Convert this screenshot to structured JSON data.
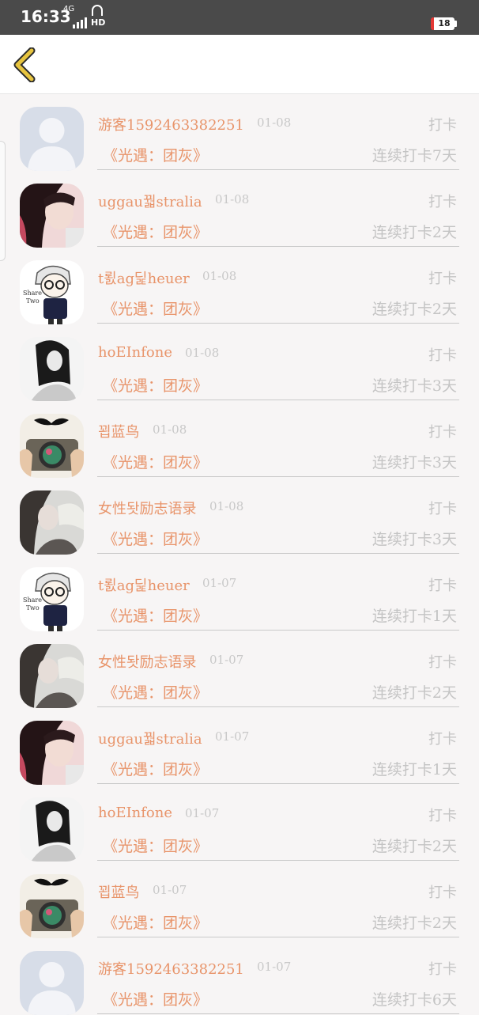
{
  "status_bar": {
    "time": "16:33",
    "network": "4G",
    "hd": "HD",
    "battery": "18"
  },
  "header": {
    "back_icon": "chevron-left-icon"
  },
  "colors": {
    "accent": "#e8946a",
    "muted": "#c4c4c4",
    "back": "#e7c43f"
  },
  "rows": [
    {
      "name": "游客1592463382251",
      "date": "01-08",
      "action": "打卡",
      "book": "《光遇：团灰》",
      "streak": "连续打卡7天",
      "avatar": "default-avatar"
    },
    {
      "name": "uggau꿟stralia",
      "date": "01-08",
      "action": "打卡",
      "book": "《光遇：团灰》",
      "streak": "连续打卡2天",
      "avatar": "girl-photo-avatar"
    },
    {
      "name": "t뢼ag딡heuer",
      "date": "01-08",
      "action": "打卡",
      "book": "《光遇：团灰》",
      "streak": "连续打卡2天",
      "avatar": "cartoon-boy-avatar"
    },
    {
      "name": "hoEInfone",
      "date": "01-08",
      "action": "打卡",
      "book": "《光遇：团灰》",
      "streak": "连续打卡3天",
      "avatar": "bw-girl-avatar"
    },
    {
      "name": "꾑蓝鸟",
      "date": "01-08",
      "action": "打卡",
      "book": "《光遇：团灰》",
      "streak": "连续打卡3天",
      "avatar": "camera-avatar"
    },
    {
      "name": "女性돳励志语录",
      "date": "01-08",
      "action": "打卡",
      "book": "《光遇：团灰》",
      "streak": "连续打卡3天",
      "avatar": "smoke-girl-avatar"
    },
    {
      "name": "t뢼ag딡heuer",
      "date": "01-07",
      "action": "打卡",
      "book": "《光遇：团灰》",
      "streak": "连续打卡1天",
      "avatar": "cartoon-boy-avatar"
    },
    {
      "name": "女性돳励志语录",
      "date": "01-07",
      "action": "打卡",
      "book": "《光遇：团灰》",
      "streak": "连续打卡2天",
      "avatar": "smoke-girl-avatar"
    },
    {
      "name": "uggau꿟stralia",
      "date": "01-07",
      "action": "打卡",
      "book": "《光遇：团灰》",
      "streak": "连续打卡1天",
      "avatar": "girl-photo-avatar"
    },
    {
      "name": "hoEInfone",
      "date": "01-07",
      "action": "打卡",
      "book": "《光遇：团灰》",
      "streak": "连续打卡2天",
      "avatar": "bw-girl-avatar"
    },
    {
      "name": "꾑蓝鸟",
      "date": "01-07",
      "action": "打卡",
      "book": "《光遇：团灰》",
      "streak": "连续打卡2天",
      "avatar": "camera-avatar"
    },
    {
      "name": "游客1592463382251",
      "date": "01-07",
      "action": "打卡",
      "book": "《光遇：团灰》",
      "streak": "连续打卡6天",
      "avatar": "default-avatar"
    }
  ]
}
